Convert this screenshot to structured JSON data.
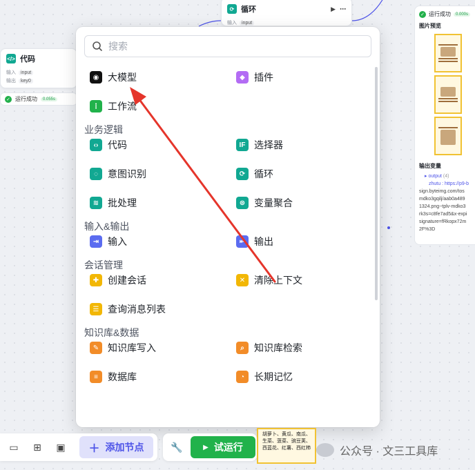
{
  "canvas": {
    "loop_node": {
      "title": "循环",
      "input_label": "输入",
      "input_value": "input"
    },
    "code_node": {
      "title": "代码",
      "input_label": "输入",
      "input_value": "input",
      "output_label": "输出",
      "output_value": "key0"
    },
    "status_left": {
      "text": "运行成功",
      "time": "0.055s"
    },
    "status_right": {
      "text": "运行成功",
      "time": "0.000s"
    },
    "right_panel": {
      "preview_title": "图片预览",
      "output_var_title": "输出变量",
      "output_key": "output",
      "output_count": "(4)",
      "output_lines": [
        "zhutu : https://p9-b",
        "sign.byteimg.com/tos",
        "mdko3gqilj/aab0a489",
        "1324.png~tplv-mdko3",
        "rk3s=c8fe7ad5&x-expi",
        "signature=fRkopx72m",
        "2F%3D"
      ]
    },
    "bottom_card_text": "胡萝卜、黄瓜、南瓜、生菜、菠菜、豌豆荚、西蓝花、红薯、西红柿"
  },
  "popup": {
    "search_placeholder": "搜索",
    "top_items": [
      {
        "label": "大模型",
        "icon": "llm-icon"
      },
      {
        "label": "插件",
        "icon": "plugin-icon"
      },
      {
        "label": "工作流",
        "icon": "workflow-icon"
      }
    ],
    "sections": [
      {
        "title": "业务逻辑",
        "items": [
          {
            "label": "代码",
            "icon": "code-icon"
          },
          {
            "label": "选择器",
            "icon": "selector-icon"
          },
          {
            "label": "意图识别",
            "icon": "intent-icon"
          },
          {
            "label": "循环",
            "icon": "loop-icon"
          },
          {
            "label": "批处理",
            "icon": "batch-icon"
          },
          {
            "label": "变量聚合",
            "icon": "aggregate-icon"
          }
        ]
      },
      {
        "title": "输入&输出",
        "items": [
          {
            "label": "输入",
            "icon": "input-icon"
          },
          {
            "label": "输出",
            "icon": "output-icon"
          }
        ]
      },
      {
        "title": "会话管理",
        "items": [
          {
            "label": "创建会话",
            "icon": "create-session-icon"
          },
          {
            "label": "清除上下文",
            "icon": "clear-context-icon"
          },
          {
            "label": "查询消息列表",
            "icon": "query-messages-icon"
          }
        ]
      },
      {
        "title": "知识库&数据",
        "items": [
          {
            "label": "知识库写入",
            "icon": "kb-write-icon"
          },
          {
            "label": "知识库检索",
            "icon": "kb-search-icon"
          },
          {
            "label": "数据库",
            "icon": "database-icon"
          },
          {
            "label": "长期记忆",
            "icon": "memory-icon"
          }
        ]
      }
    ]
  },
  "toolbar": {
    "add_node_label": "添加节点",
    "run_label": "试运行"
  },
  "watermark": "公众号 · 文三工具库",
  "colors": {
    "accent": "#4d53e8",
    "green": "#21b24b",
    "blue": "#5b6cf0",
    "teal": "#11a892",
    "orange": "#f28c28",
    "yellow": "#f2b705",
    "purple": "#b36cf4",
    "arrow": "#e5352b"
  }
}
